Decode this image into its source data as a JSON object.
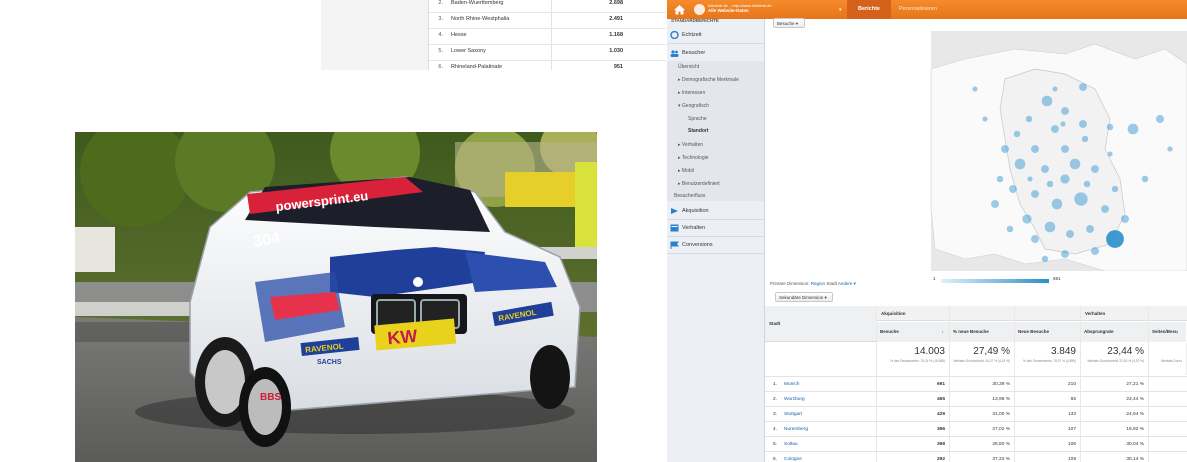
{
  "region_table": {
    "rows": [
      {
        "rank": "2.",
        "name": "Baden-Wuerttemberg",
        "value": "2.698"
      },
      {
        "rank": "3.",
        "name": "North Rhine-Westphalia",
        "value": "2.491"
      },
      {
        "rank": "4.",
        "name": "Hesse",
        "value": "1.168"
      },
      {
        "rank": "5.",
        "name": "Lower Saxony",
        "value": "1.030"
      },
      {
        "rank": "6.",
        "name": "Rhineland-Palatinate",
        "value": "951"
      }
    ]
  },
  "photo": {
    "banner_text": "powersprint.eu",
    "car_number": "304",
    "sponsor_1": "RAVENOL",
    "sponsor_2": "SACHS",
    "sponsor_3": "KW",
    "sponsor_4": "BBS"
  },
  "ga": {
    "topbar": {
      "site_line1": "hillclimb.de – http://www.hillclimb.de",
      "site_line2": "Alle Website-Daten",
      "tab_active": "Berichte",
      "tab_other": "Personalisieren"
    },
    "sidebar": {
      "standard_reports": "STANDARDBERICHTE",
      "sections": {
        "echtzeit": "Echtzeit",
        "besucher": "Besucher",
        "akquisition": "Akquisition",
        "verhalten": "Verhalten",
        "conversions": "Conversions"
      },
      "besucher_sub": {
        "uebersicht": "Übersicht",
        "demografische": "▸ Demografische Merkmale",
        "interessen": "▸ Interessen",
        "geografisch": "▾ Geografisch",
        "sprache": "Sprache",
        "standort": "Standort",
        "verhalten": "▸ Verhalten",
        "technologie": "▸ Technologie",
        "mobil": "▸ Mobil",
        "benutzerdefiniert": "▸ Benutzerdefiniert",
        "besucherfluss": "Besucherfluss"
      }
    },
    "segment_button": "Besuche ▾",
    "map": {
      "legend_min": "1",
      "legend_max": "691",
      "bubble_color": "#2a8fcc"
    },
    "dimension_row": {
      "label": "Primäre Dimension:",
      "region": "Region",
      "stadt": "Stadt",
      "andere": "Andere ▾"
    },
    "secondary_dim_button": "Sekundäre Dimension ▾",
    "table": {
      "group_akquisition": "Akquisition",
      "group_verhalten": "Verhalten",
      "headers": {
        "stadt": "Stadt",
        "besuche": "Besuche",
        "neue_besuche_pct": "% neue Besuche",
        "neue_besuche": "Neue Besuche",
        "absprungrate": "Absprungrate",
        "seiten": "Seiten/Besu"
      },
      "totals": {
        "besuche": "14.003",
        "besuche_sub": "% des Gesamtwerts: 75,34 % (18.586)",
        "neue_pct": "27,49 %",
        "neue_pct_sub": "Website-Durchschnitt: 26,37 % (4,18 %)",
        "neue": "3.849",
        "neue_sub": "% des Gesamtwerts: 78,57 % (4.899)",
        "absprung": "23,44 %",
        "absprung_sub": "Website-Durchschnitt: 22,50 % (4,20 %)",
        "seiten_sub": "Website-Durch"
      },
      "rows": [
        {
          "rank": "1.",
          "city": "Munich",
          "besuche": "691",
          "neue_pct": "30,39 %",
          "neue": "210",
          "absprung": "27,21 %"
        },
        {
          "rank": "2.",
          "city": "Wurzburg",
          "besuche": "465",
          "neue_pct": "13,98 %",
          "neue": "65",
          "absprung": "23,44 %"
        },
        {
          "rank": "3.",
          "city": "Stuttgart",
          "besuche": "429",
          "neue_pct": "31,00 %",
          "neue": "133",
          "absprung": "24,94 %"
        },
        {
          "rank": "4.",
          "city": "Nuremberg",
          "besuche": "396",
          "neue_pct": "27,02 %",
          "neue": "107",
          "absprung": "16,92 %"
        },
        {
          "rank": "5.",
          "city": "Soltau",
          "besuche": "368",
          "neue_pct": "28,80 %",
          "neue": "106",
          "absprung": "30,04 %"
        },
        {
          "rank": "6.",
          "city": "Cologne",
          "besuche": "292",
          "neue_pct": "37,33 %",
          "neue": "109",
          "absprung": "30,14 %"
        }
      ]
    }
  }
}
